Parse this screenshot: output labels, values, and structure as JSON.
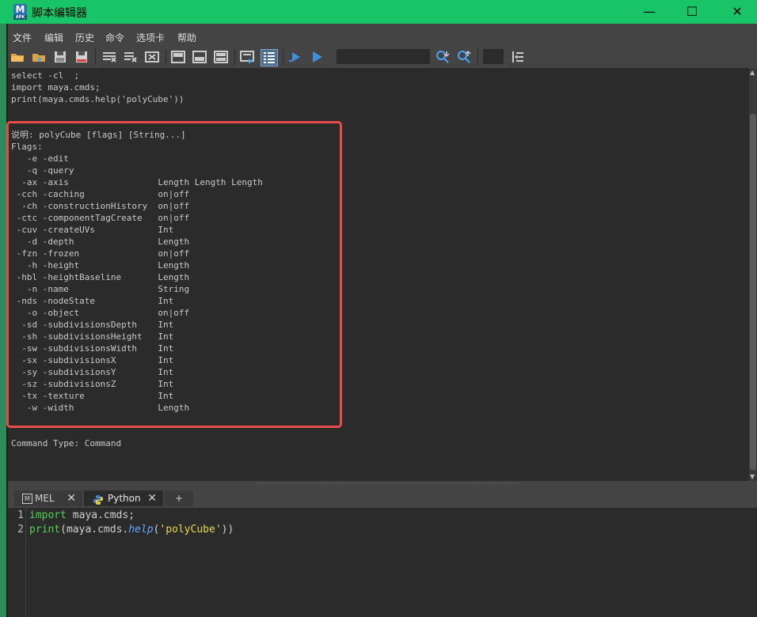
{
  "window": {
    "title": "脚本编辑器",
    "app_icon_letter": "M",
    "app_icon_sub": "APK"
  },
  "window_controls": {
    "minimize": "—",
    "maximize": "☐",
    "close": "✕"
  },
  "menu": [
    "文件",
    "编辑",
    "历史",
    "命令",
    "选项卡",
    "帮助"
  ],
  "output": {
    "lines": [
      "select -cl  ;",
      "import maya.cmds;",
      "print(maya.cmds.help('polyCube'))",
      "",
      "",
      "说明: polyCube [flags] [String...]",
      "Flags:",
      "   -e -edit",
      "   -q -query",
      "  -ax -axis                 Length Length Length",
      " -cch -caching              on|off",
      "  -ch -constructionHistory  on|off",
      " -ctc -componentTagCreate   on|off",
      " -cuv -createUVs            Int",
      "   -d -depth                Length",
      " -fzn -frozen               on|off",
      "   -h -height               Length",
      " -hbl -heightBaseline       Length",
      "   -n -name                 String",
      " -nds -nodeState            Int",
      "   -o -object               on|off",
      "  -sd -subdivisionsDepth    Int",
      "  -sh -subdivisionsHeight   Int",
      "  -sw -subdivisionsWidth    Int",
      "  -sx -subdivisionsX        Int",
      "  -sy -subdivisionsY        Int",
      "  -sz -subdivisionsZ        Int",
      "  -tx -texture              Int",
      "   -w -width                Length",
      "",
      "",
      "Command Type: Command"
    ]
  },
  "tabs": [
    {
      "label": "MEL",
      "icon": "mel-icon"
    },
    {
      "label": "Python",
      "icon": "python-icon"
    }
  ],
  "add_tab_label": "+",
  "editor": {
    "line_numbers": [
      "1",
      "2"
    ],
    "line1": {
      "kw": "import",
      "rest": " maya.cmds;"
    },
    "line2": {
      "kw": "print",
      "p1": "(maya.cmds.",
      "fn": "help",
      "p2": "(",
      "str": "'polyCube'",
      "p3": "))"
    }
  }
}
